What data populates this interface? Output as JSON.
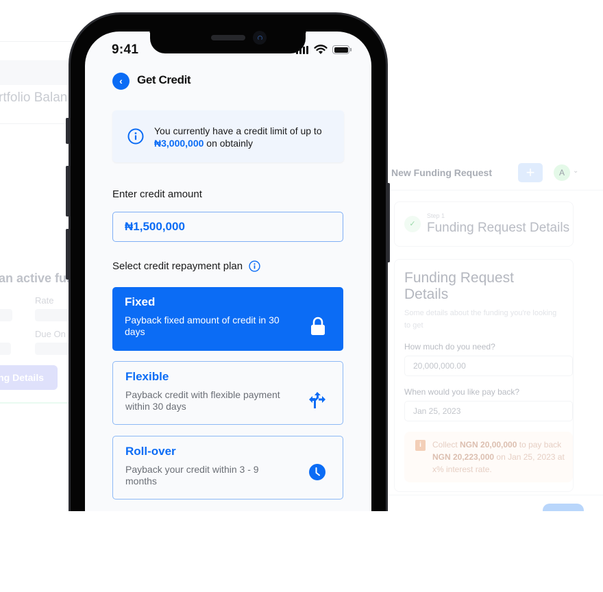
{
  "background_left": {
    "portfolio_label": "rtfolio Balan",
    "active_funding_title": "an active fun",
    "rate_label": "Rate",
    "due_on_label": "Due On",
    "details_button": "ng Details"
  },
  "background_right": {
    "header_title": "New Funding Request",
    "plus_button": "+",
    "avatar_initial": "A",
    "step_label": "Step 1",
    "step_title": "Funding Request Details",
    "form_title": "Funding Request Details",
    "form_subtitle": "Some details about the funding you're looking to get",
    "amount_question": "How much do you need?",
    "amount_value": "20,000,000.00",
    "payback_question": "When would you like pay back?",
    "payback_value": "Jan 25, 2023",
    "note": {
      "prefix": "Collect ",
      "collect_amount": "NGN 20,00,000",
      "middle": " to pay back ",
      "payback_amount": "NGN 20,223,000",
      "suffix": " on Jan 25, 2023 at x% interest rate."
    }
  },
  "phone": {
    "status_bar": {
      "time": "9:41"
    },
    "header": {
      "title": "Get Credit",
      "back_icon": "chevron-left-icon"
    },
    "info_banner": {
      "text_before": "You currently have a credit limit of up to ",
      "limit_amount": "₦3,000,000",
      "text_after": " on obtainly"
    },
    "credit_amount": {
      "label": "Enter credit amount",
      "value": "₦1,500,000"
    },
    "repayment_plan": {
      "label": "Select credit repayment plan",
      "selected": "Fixed",
      "options": [
        {
          "title": "Fixed",
          "description": "Payback fixed amount of credit in 30 days",
          "icon": "lock-icon"
        },
        {
          "title": "Flexible",
          "description": "Payback credit with flexible payment within 30 days",
          "icon": "directions-icon"
        },
        {
          "title": "Roll-over",
          "description": "Payback your credit within 3 - 9 months",
          "icon": "clock-icon"
        }
      ]
    }
  },
  "colors": {
    "accent": "#0b6cf5",
    "screen_bg": "#f9fafc",
    "info_bg": "#f0f5fd",
    "phone_frame": "#2a2b30"
  }
}
